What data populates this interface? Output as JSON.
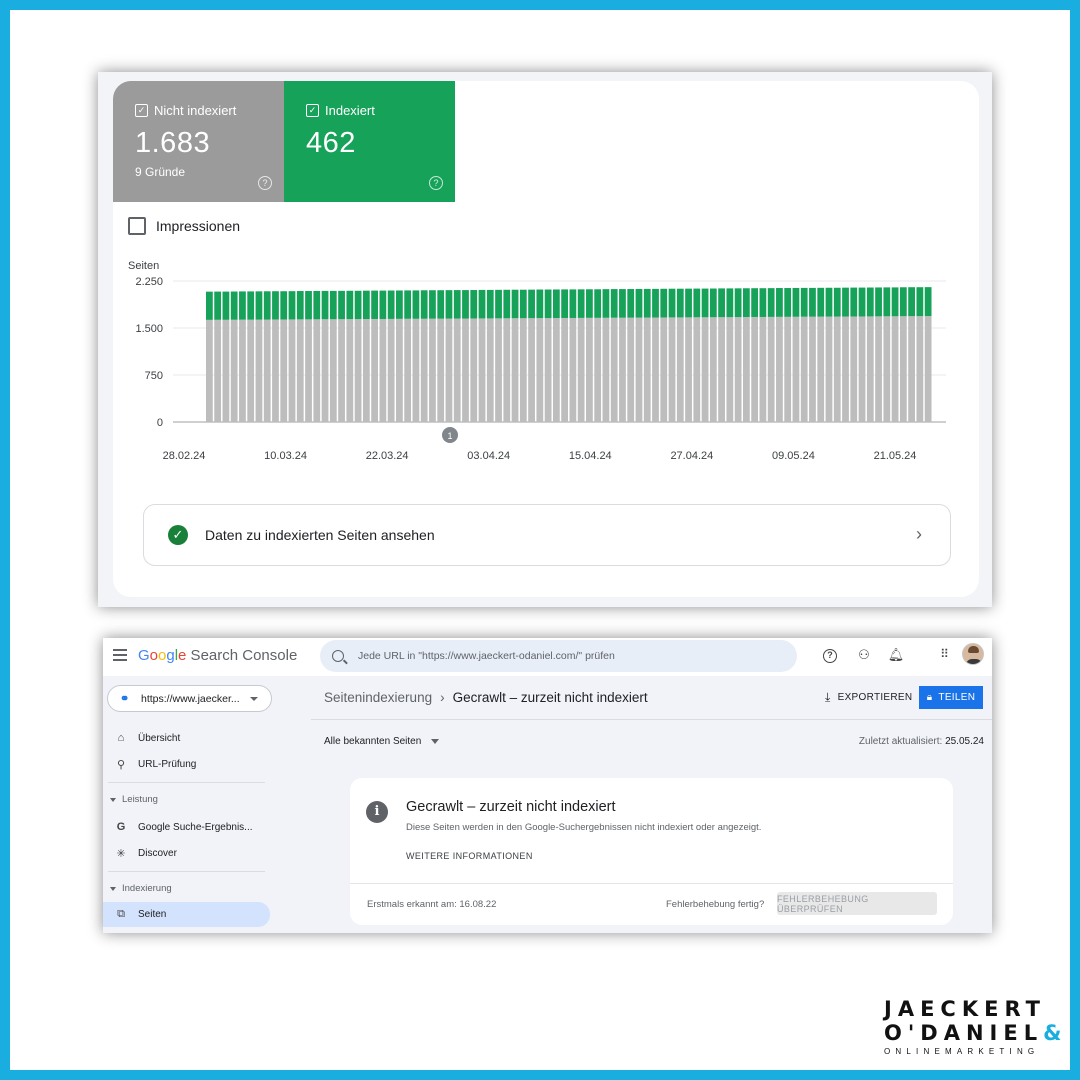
{
  "top_card": {
    "tile_not_indexed": {
      "label": "Nicht indexiert",
      "value": "1.683",
      "sub": "9 Gründe",
      "color": "#9b9b9b"
    },
    "tile_indexed": {
      "label": "Indexiert",
      "value": "462",
      "color": "#17a25a"
    },
    "impressions_label": "Impressionen",
    "info_row_label": "Daten zu indexierten Seiten ansehen"
  },
  "chart_data": {
    "type": "bar",
    "stacked": true,
    "ylabel": "Seiten",
    "ylim": [
      0,
      2250
    ],
    "yticks": [
      "2.250",
      "1.500",
      "750",
      "0"
    ],
    "ytick_values": [
      2250,
      1500,
      750,
      0
    ],
    "xtick_labels": [
      "28.02.24",
      "10.03.24",
      "22.03.24",
      "03.04.24",
      "15.04.24",
      "27.04.24",
      "09.05.24",
      "21.05.24"
    ],
    "annotation_marker": "1",
    "num_bars": 88,
    "series": [
      {
        "name": "Nicht indexiert",
        "color": "#bdbdbd",
        "start": 1630,
        "end": 1690
      },
      {
        "name": "Indexiert",
        "color": "#17a25a",
        "start": 450,
        "end": 462
      }
    ]
  },
  "console": {
    "app_title_parts": [
      "G",
      "o",
      "o",
      "g",
      "l",
      "e"
    ],
    "app_title_rest": " Search Console",
    "search_placeholder": "Jede URL in \"https://www.jaeckert-odaniel.com/\" prüfen",
    "property": "https://www.jaecker...",
    "nav": {
      "overview": "Übersicht",
      "url_check": "URL-Prüfung",
      "section_performance": "Leistung",
      "google_results": "Google Suche-Ergebnis...",
      "discover": "Discover",
      "section_indexing": "Indexierung",
      "pages": "Seiten"
    },
    "breadcrumb_parent": "Seitenindexierung",
    "breadcrumb_sep": "›",
    "breadcrumb_current": "Gecrawlt – zurzeit nicht indexiert",
    "export_label": "EXPORTIEREN",
    "share_label": "TEILEN",
    "filter_label": "Alle bekannten Seiten",
    "updated_label": "Zuletzt aktualisiert:",
    "updated_value": "25.05.24",
    "card": {
      "title": "Gecrawlt – zurzeit nicht indexiert",
      "description": "Diese Seiten werden in den Google-Suchergebnissen nicht indexiert oder angezeigt.",
      "more_info": "WEITERE INFORMATIONEN",
      "first_detected": "Erstmals erkannt am: 16.08.22",
      "fix_done": "Fehlerbehebung fertig?",
      "verify_fix": "FEHLERBEHEBUNG ÜBERPRÜFEN"
    }
  },
  "logo": {
    "line1": "JAECKERT",
    "line2": "O'DANIEL",
    "amp": "&",
    "line3": "ONLINEMARKETING"
  }
}
